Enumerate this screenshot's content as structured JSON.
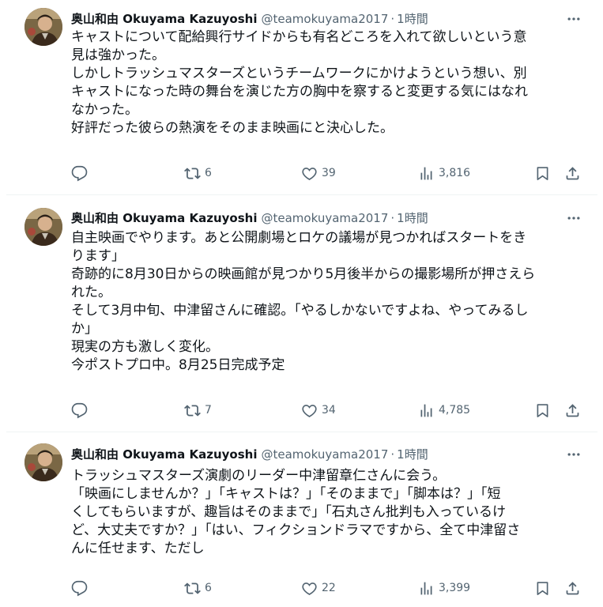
{
  "colors": {
    "text": "#0f1419",
    "secondary": "#536471",
    "divider": "#eff3f4"
  },
  "tweets": [
    {
      "name": "奥山和由 Okuyama Kazuyoshi",
      "handle": "@teamokuyama2017",
      "separator": "·",
      "time": "1時間",
      "text": "キャストについて配給興行サイドからも有名どころを入れて欲しいという意\n見は強かった。\nしかしトラッシュマスターズというチームワークにかけようという想い、別\nキャストになった時の舞台を演じた方の胸中を察すると変更する気にはなれ\nなかった。\n好評だった彼らの熱演をそのまま映画にと決心した。",
      "retweets": "6",
      "likes": "39",
      "views": "3,816"
    },
    {
      "name": "奥山和由 Okuyama Kazuyoshi",
      "handle": "@teamokuyama2017",
      "separator": "·",
      "time": "1時間",
      "text": "自主映画でやります。あと公開劇場とロケの議場が見つかればスタートをき\nります」\n奇跡的に8月30日からの映画館が見つかり5月後半からの撮影場所が押さえら\nれた。\nそして3月中旬、中津留さんに確認。「やるしかないですよね、やってみるし\nか」\n現実の方も激しく変化。\n今ポストプロ中。8月25日完成予定",
      "retweets": "7",
      "likes": "34",
      "views": "4,785"
    },
    {
      "name": "奥山和由 Okuyama Kazuyoshi",
      "handle": "@teamokuyama2017",
      "separator": "·",
      "time": "1時間",
      "text": "トラッシュマスターズ演劇のリーダー中津留章仁さんに会う。\n「映画にしませんか？」「キャストは？」「そのままで」「脚本は？」「短\nくしてもらいますが、趣旨はそのままで」「石丸さん批判も入っているけ\nど、大丈夫ですか？」「はい、フィクションドラマですから、全て中津留さ\nんに任せます、ただし",
      "retweets": "6",
      "likes": "22",
      "views": "3,399"
    }
  ]
}
